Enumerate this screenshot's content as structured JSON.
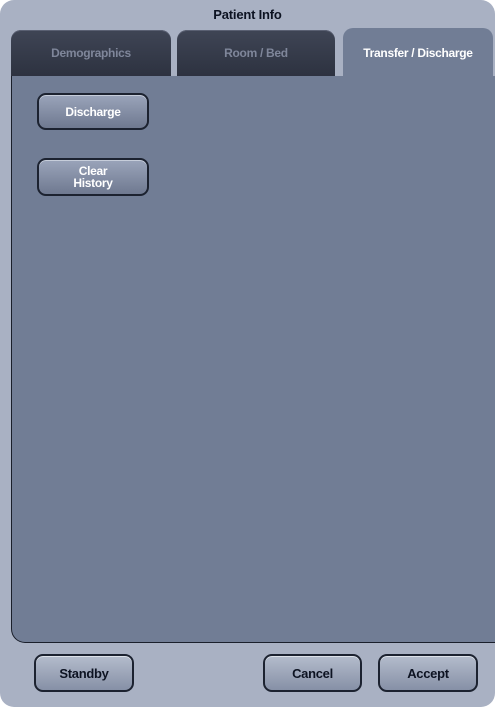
{
  "window": {
    "title": "Patient Info"
  },
  "tabs": [
    {
      "label": "Demographics",
      "active": false
    },
    {
      "label": "Room / Bed",
      "active": false
    },
    {
      "label": "Transfer / Discharge",
      "active": true
    }
  ],
  "panel": {
    "discharge_label": "Discharge",
    "clear_history_label": "Clear\nHistory"
  },
  "footer": {
    "standby_label": "Standby",
    "cancel_label": "Cancel",
    "accept_label": "Accept"
  },
  "colors": {
    "window_bg": "#a9b1c3",
    "panel_bg": "#717d95",
    "inactive_tab": "#2d3240",
    "active_tab_text": "#ffffff"
  }
}
